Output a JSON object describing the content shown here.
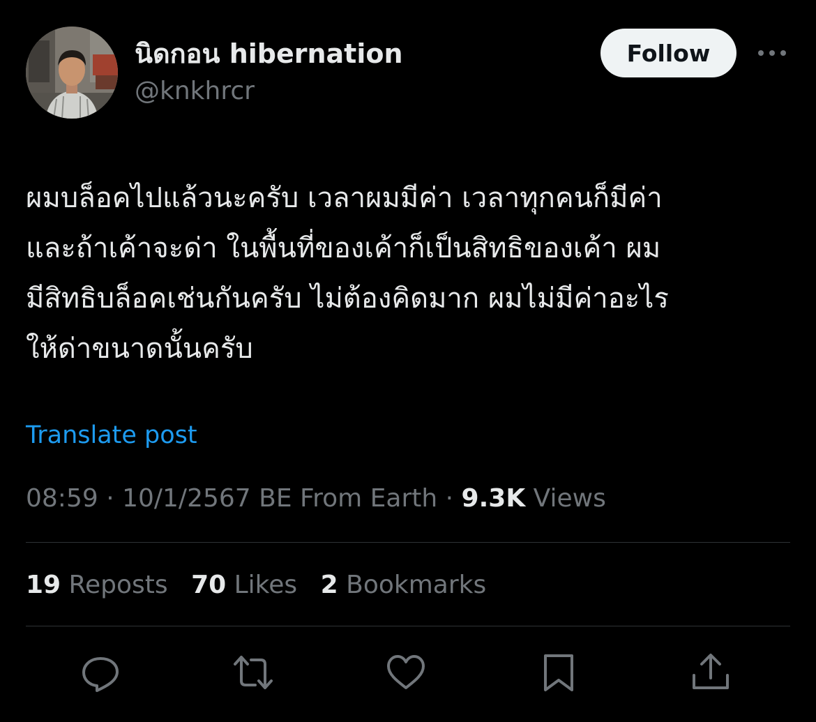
{
  "author": {
    "display_name": "นิดกอน hibernation",
    "handle": "@knkhrcr"
  },
  "header": {
    "follow_label": "Follow",
    "more_icon": "more-horizontal-icon"
  },
  "post": {
    "lines": [
      "ผมบล็อคไปแล้วนะครับ เวลาผมมีค่า เวลาทุกคนก็มีค่า",
      "และถ้าเค้าจะด่า ในพื้นที่ของเค้าก็เป็นสิทธิของเค้า ผม",
      "มีสิทธิบล็อคเช่นกันครับ ไม่ต้องคิดมาก ผมไม่มีค่าอะไร",
      "ให้ด่าขนาดนั้นครับ"
    ],
    "translate_label": "Translate post"
  },
  "meta": {
    "time": "08:59",
    "sep1": " · ",
    "date": "10/1/2567 BE",
    "source": " From Earth",
    "sep2": " · ",
    "views_count": "9.3K",
    "views_label": " Views"
  },
  "stats": {
    "reposts_count": "19",
    "reposts_label": " Reposts",
    "likes_count": "70",
    "likes_label": " Likes",
    "bookmarks_count": "2",
    "bookmarks_label": " Bookmarks"
  },
  "actions": {
    "icons": [
      "reply-icon",
      "repost-icon",
      "like-icon",
      "bookmark-icon",
      "share-icon"
    ]
  },
  "colors": {
    "background": "#000000",
    "primary_text": "#e7e9ea",
    "secondary_text": "#71767b",
    "link": "#1d9bf0",
    "divider": "#2f3336",
    "follow_bg": "#eff3f4"
  }
}
